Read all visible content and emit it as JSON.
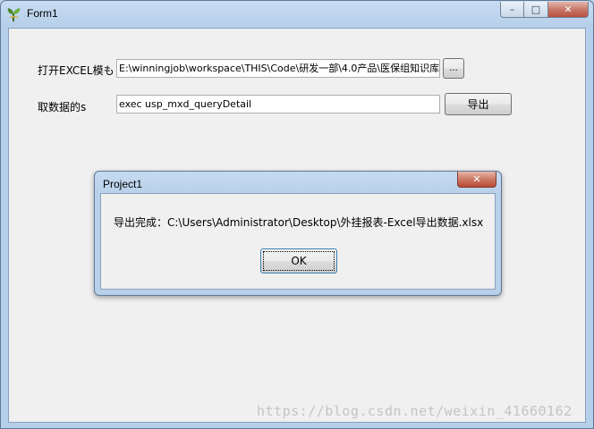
{
  "window": {
    "title": "Form1"
  },
  "caption": {
    "minimize": "–",
    "maximize": "□",
    "close": "✕"
  },
  "form": {
    "template_label": "打开EXCEL模も",
    "template_path": "E:\\winningjob\\workspace\\THIS\\Code\\研发一部\\4.0产品\\医保组知识库",
    "browse_button": "...",
    "sql_label": "取数据的s",
    "sql_value": "exec usp_mxd_queryDetail",
    "export_button": "导出"
  },
  "dialog": {
    "title": "Project1",
    "close": "✕",
    "message": "导出完成：C:\\Users\\Administrator\\Desktop\\外挂报表-Excel导出数据.xlsx",
    "ok_button": "OK"
  },
  "watermark": "https://blog.csdn.net/weixin_41660162"
}
